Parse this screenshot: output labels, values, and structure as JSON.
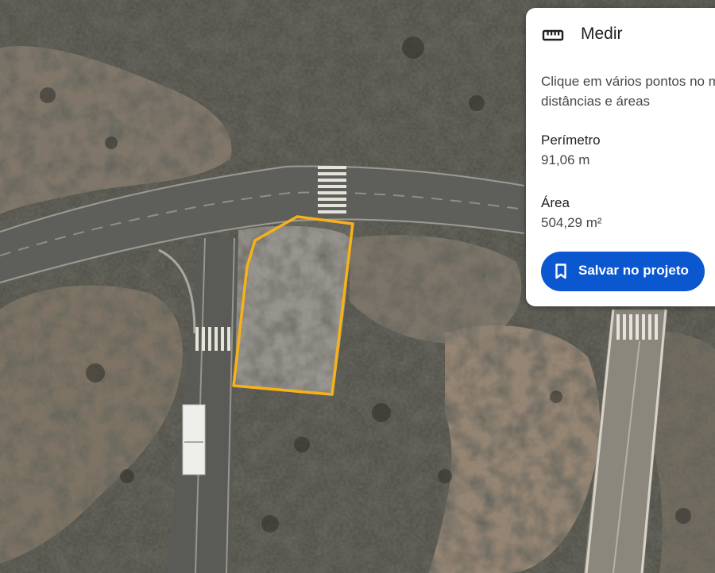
{
  "measure_panel": {
    "title": "Medir",
    "icon": "ruler-icon",
    "description": "Clique em vários pontos no m\ndistâncias e áreas",
    "perimeter": {
      "label": "Perímetro",
      "value": "91,06 m"
    },
    "area": {
      "label": "Área",
      "value": "504,29 m²"
    },
    "save_button": {
      "label": "Salvar no projeto",
      "icon": "bookmark-icon"
    }
  },
  "map": {
    "view": "satellite",
    "measured_polygon_color": "#f7b21a"
  },
  "colors": {
    "primary_button": "#0b57d0",
    "panel_background": "#ffffff"
  }
}
